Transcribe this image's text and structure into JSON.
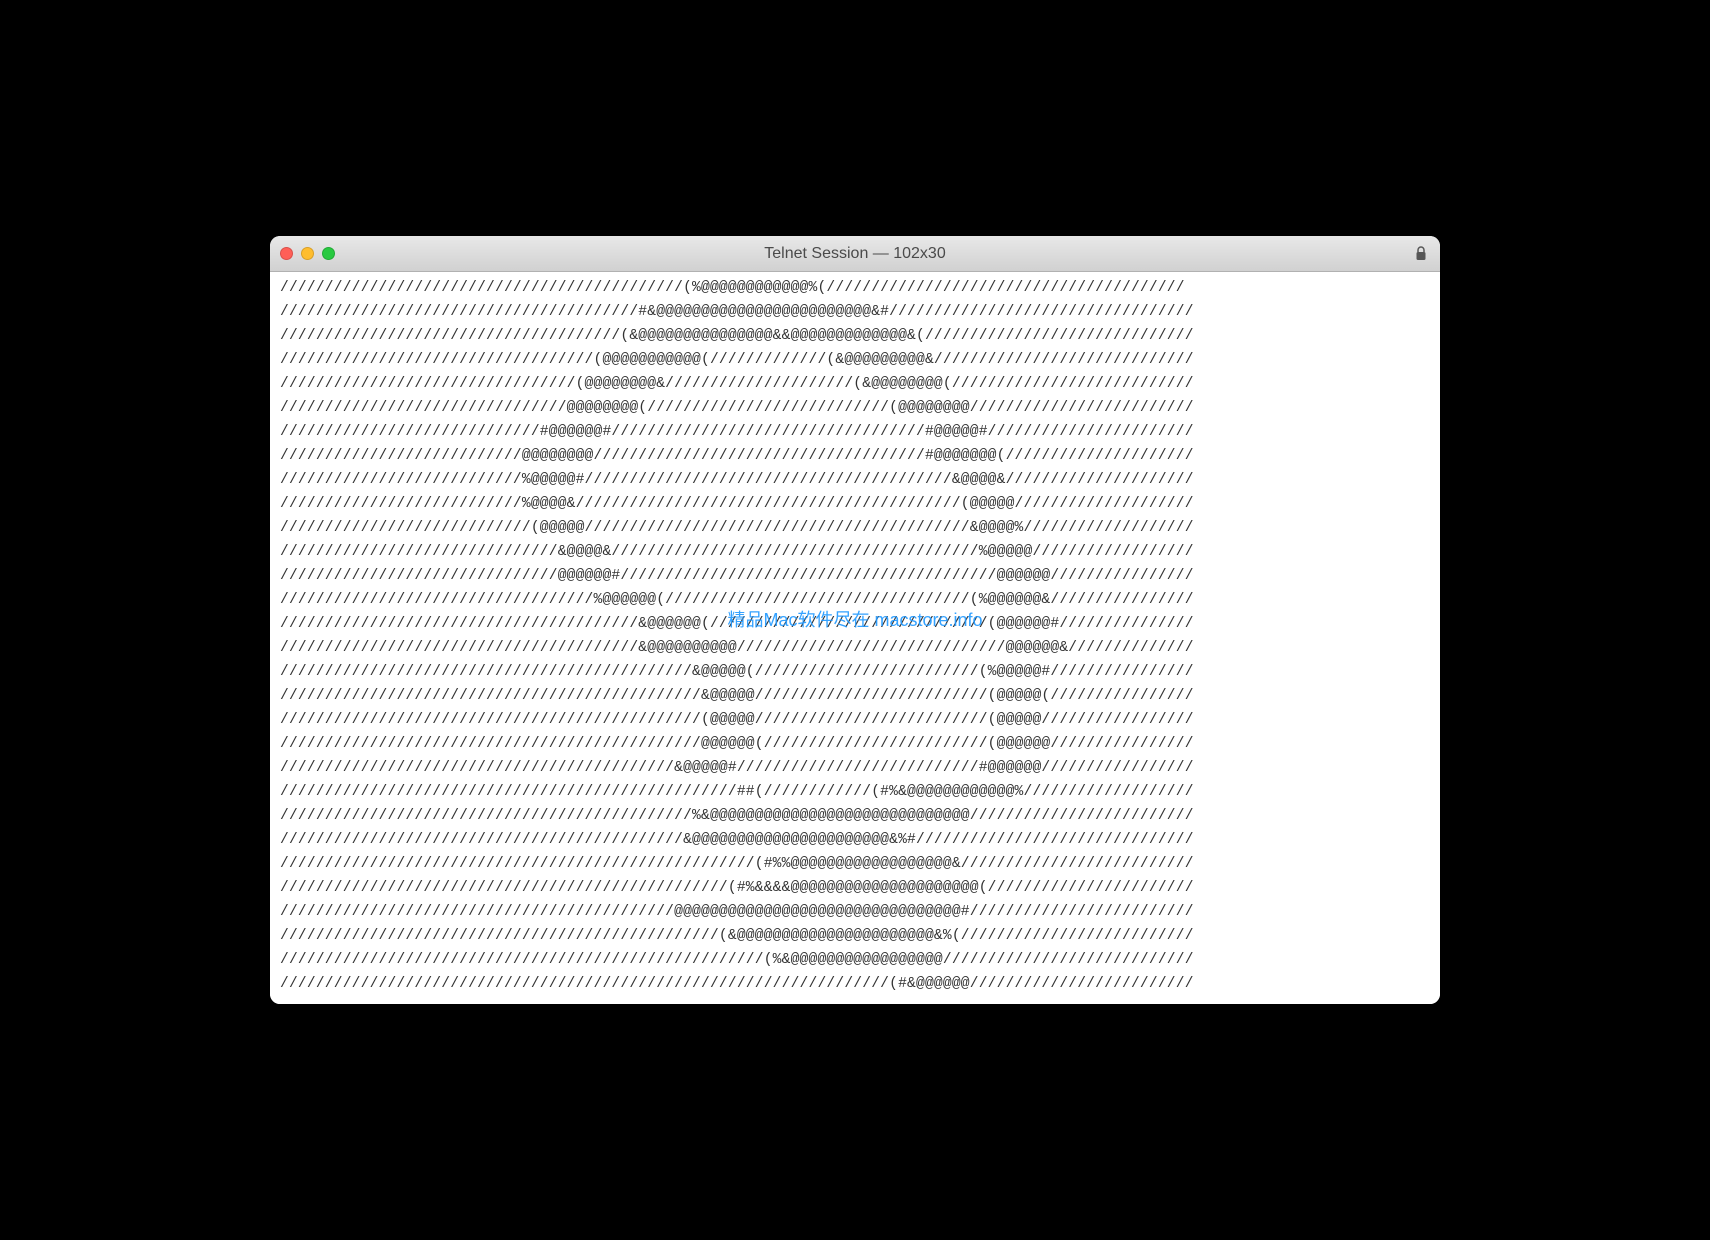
{
  "window": {
    "title": "Telnet Session — 102x30"
  },
  "watermark": "精品Mac软件尽在 macstore.info",
  "terminal": {
    "lines": [
      "/////////////////////////////////////////////(%@@@@@@@@@@@@%(////////////////////////////////////////",
      "////////////////////////////////////////#&@@@@@@@@@@@@@@@@@@@@@@@@&#//////////////////////////////////",
      "//////////////////////////////////////(&@@@@@@@@@@@@@@@&&@@@@@@@@@@@@@&(//////////////////////////////",
      "///////////////////////////////////(@@@@@@@@@@@(/////////////(&@@@@@@@@@&/////////////////////////////",
      "/////////////////////////////////(@@@@@@@@&/////////////////////(&@@@@@@@@(///////////////////////////",
      "////////////////////////////////@@@@@@@@(///////////////////////////(@@@@@@@@/////////////////////////",
      "/////////////////////////////#@@@@@@#///////////////////////////////////#@@@@@#///////////////////////",
      "///////////////////////////@@@@@@@@/////////////////////////////////////#@@@@@@@(/////////////////////",
      "///////////////////////////%@@@@@#/////////////////////////////////////////&@@@@&/////////////////////",
      "///////////////////////////%@@@@&///////////////////////////////////////////(@@@@@////////////////////",
      "////////////////////////////(@@@@@///////////////////////////////////////////&@@@@%///////////////////",
      "///////////////////////////////&@@@@&/////////////////////////////////////////%@@@@@//////////////////",
      "///////////////////////////////@@@@@@#//////////////////////////////////////////@@@@@@////////////////",
      "///////////////////////////////////%@@@@@@(//////////////////////////////////(%@@@@@@&////////////////",
      "////////////////////////////////////////&@@@@@@(///////////////////////////////(@@@@@@#///////////////",
      "////////////////////////////////////////&@@@@@@@@@@//////////////////////////////@@@@@@&//////////////",
      "//////////////////////////////////////////////&@@@@@(/////////////////////////(%@@@@@#////////////////",
      "///////////////////////////////////////////////&@@@@@//////////////////////////(@@@@@(////////////////",
      "///////////////////////////////////////////////(@@@@@//////////////////////////(@@@@@/////////////////",
      "///////////////////////////////////////////////@@@@@@(/////////////////////////(@@@@@@////////////////",
      "////////////////////////////////////////////&@@@@@#///////////////////////////#@@@@@@/////////////////",
      "///////////////////////////////////////////////////##(////////////(#%&@@@@@@@@@@@@%///////////////////",
      "//////////////////////////////////////////////%&@@@@@@@@@@@@@@@@@@@@@@@@@@@@@/////////////////////////",
      "/////////////////////////////////////////////&@@@@@@@@@@@@@@@@@@@@@@&%#///////////////////////////////",
      "/////////////////////////////////////////////////////(#%%@@@@@@@@@@@@@@@@@@&//////////////////////////",
      "//////////////////////////////////////////////////(#%&&&&@@@@@@@@@@@@@@@@@@@@@(///////////////////////",
      "////////////////////////////////////////////@@@@@@@@@@@@@@@@@@@@@@@@@@@@@@@@#/////////////////////////",
      "/////////////////////////////////////////////////(&@@@@@@@@@@@@@@@@@@@@@@&%(//////////////////////////",
      "//////////////////////////////////////////////////////(%&@@@@@@@@@@@@@@@@@////////////////////////////",
      "////////////////////////////////////////////////////////////////////(#&@@@@@@/////////////////////////"
    ]
  }
}
